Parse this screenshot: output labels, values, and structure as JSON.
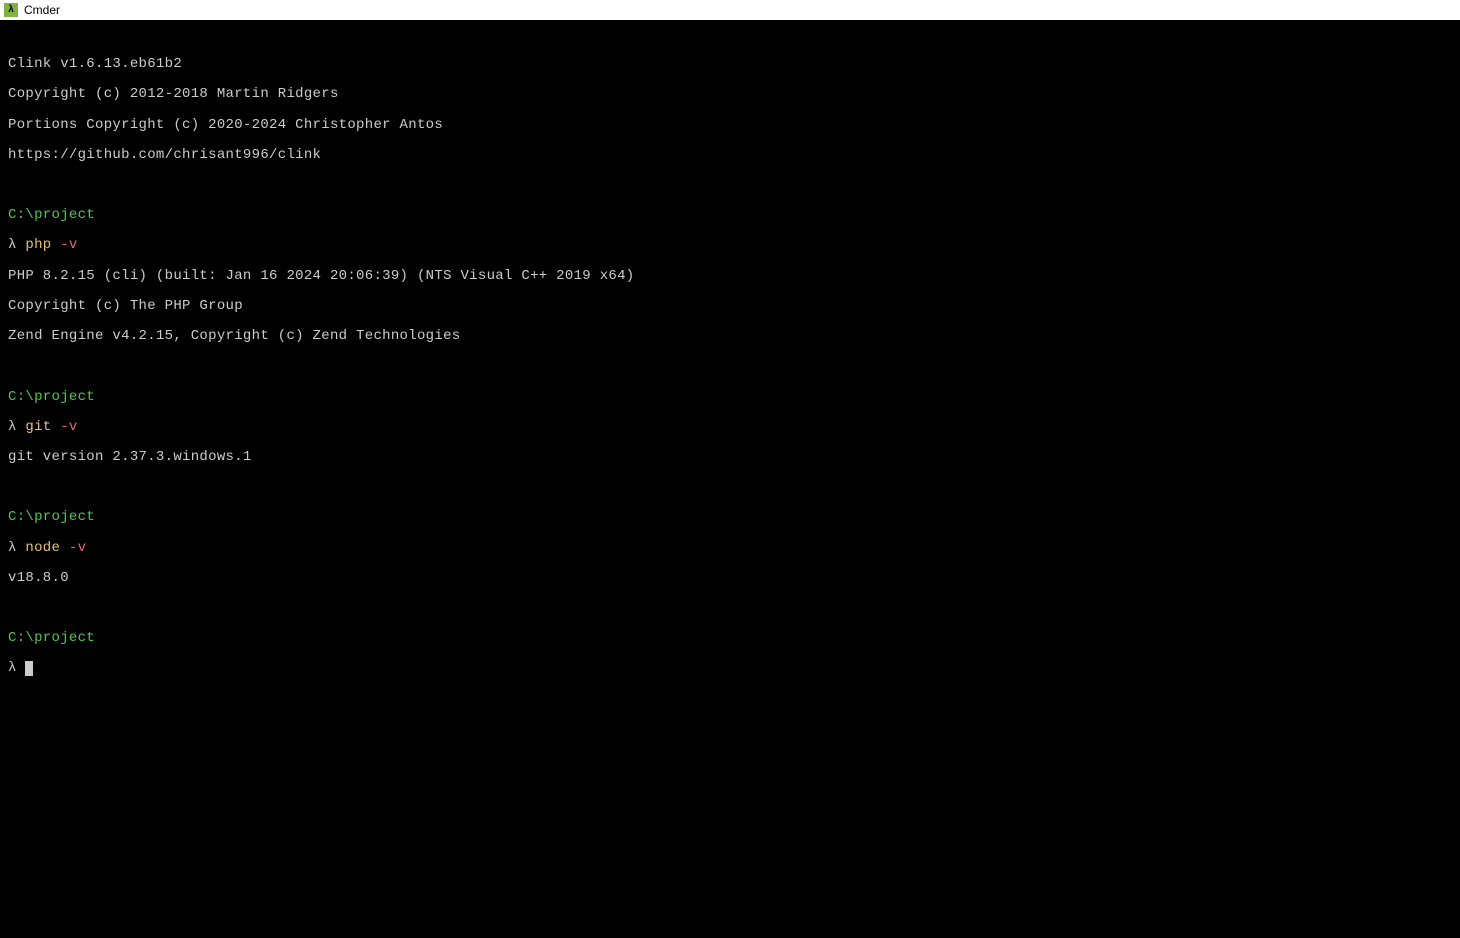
{
  "window": {
    "title": "Cmder",
    "icon_glyph": "λ"
  },
  "terminal": {
    "clink_header": {
      "line1": "Clink v1.6.13.eb61b2",
      "line2": "Copyright (c) 2012-2018 Martin Ridgers",
      "line3": "Portions Copyright (c) 2020-2024 Christopher Antos",
      "line4": "https://github.com/chrisant996/clink"
    },
    "blocks": [
      {
        "path": "C:\\project",
        "prompt": "λ",
        "command": "php",
        "flag": "-v",
        "output": [
          "PHP 8.2.15 (cli) (built: Jan 16 2024 20:06:39) (NTS Visual C++ 2019 x64)",
          "Copyright (c) The PHP Group",
          "Zend Engine v4.2.15, Copyright (c) Zend Technologies"
        ]
      },
      {
        "path": "C:\\project",
        "prompt": "λ",
        "command": "git",
        "flag": "-v",
        "output": [
          "git version 2.37.3.windows.1"
        ]
      },
      {
        "path": "C:\\project",
        "prompt": "λ",
        "command": "node",
        "flag": "-v",
        "output": [
          "v18.8.0"
        ]
      },
      {
        "path": "C:\\project",
        "prompt": "λ",
        "command": "",
        "flag": "",
        "output": []
      }
    ]
  }
}
